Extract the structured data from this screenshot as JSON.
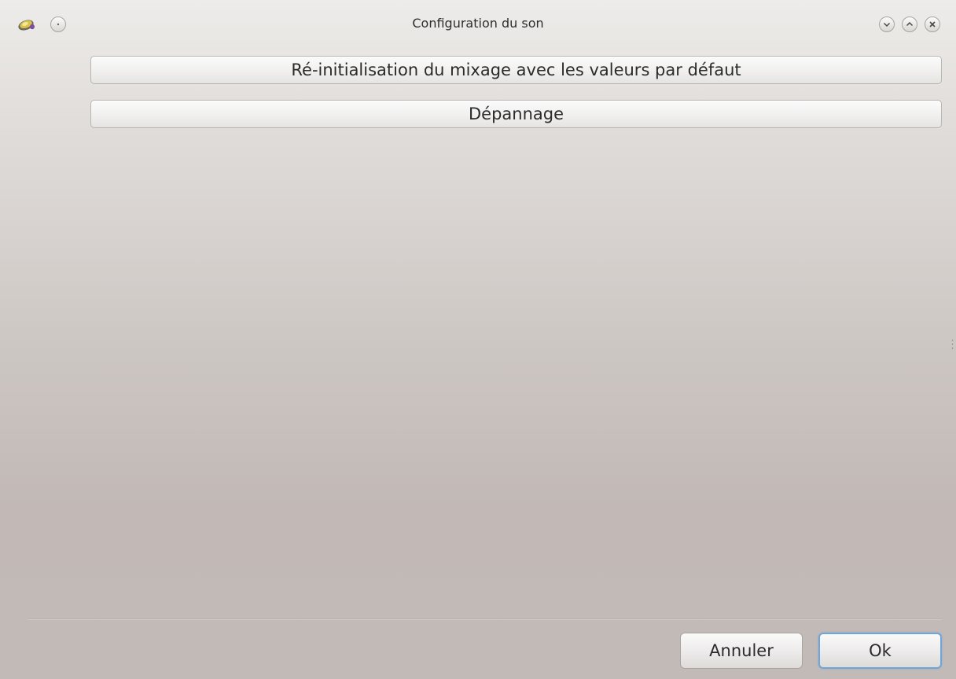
{
  "window": {
    "title": "Configuration du son"
  },
  "titlebar": {
    "app_icon": "speaker-icon",
    "menu_icon": "window-menu-icon",
    "minimize_icon": "minimize-icon",
    "maximize_icon": "maximize-icon",
    "close_icon": "close-icon"
  },
  "main": {
    "reset_mixer_label": "Ré-initialisation du mixage avec les valeurs par défaut",
    "troubleshoot_label": "Dépannage"
  },
  "footer": {
    "cancel_label": "Annuler",
    "ok_label": "Ok"
  },
  "colors": {
    "focus_accent": "#6fa5d8"
  }
}
